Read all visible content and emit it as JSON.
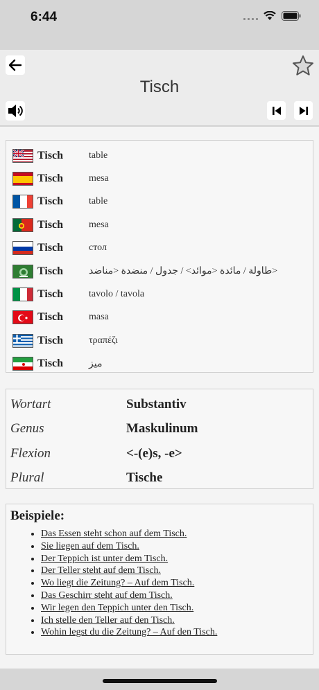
{
  "status": {
    "time": "6:44"
  },
  "header": {
    "title": "Tisch"
  },
  "translations": [
    {
      "flag": "us-uk",
      "word": "Tisch",
      "translation": "table"
    },
    {
      "flag": "spain",
      "word": "Tisch",
      "translation": "mesa"
    },
    {
      "flag": "france",
      "word": "Tisch",
      "translation": "table"
    },
    {
      "flag": "portugal",
      "word": "Tisch",
      "translation": "mesa"
    },
    {
      "flag": "russia",
      "word": "Tisch",
      "translation": "стол"
    },
    {
      "flag": "arabic",
      "word": "Tisch",
      "translation": "طاولة / مائدة <موائد> / جدول / منضدة <مناضد>"
    },
    {
      "flag": "italy",
      "word": "Tisch",
      "translation": "tavolo / tavola"
    },
    {
      "flag": "turkey",
      "word": "Tisch",
      "translation": "masa"
    },
    {
      "flag": "greece",
      "word": "Tisch",
      "translation": "τραπέζι"
    },
    {
      "flag": "iran",
      "word": "Tisch",
      "translation": "میز"
    }
  ],
  "grammar": [
    {
      "label": "Wortart",
      "value": "Substantiv"
    },
    {
      "label": "Genus",
      "value": "Maskulinum"
    },
    {
      "label": "Flexion",
      "value": "<-(e)s, -e>"
    },
    {
      "label": "Plural",
      "value": "Tische"
    }
  ],
  "examples": {
    "title": "Beispiele:",
    "items": [
      "Das Essen steht schon auf dem Tisch.",
      "Sie liegen auf dem Tisch.",
      "Der Teppich ist unter dem Tisch.",
      "Der Teller steht auf dem Tisch.",
      "Wo liegt die Zeitung? – Auf dem Tisch.",
      "Das Geschirr steht auf dem Tisch.",
      "Wir legen den Teppich unter den Tisch.",
      "Ich stelle den Teller auf den Tisch.",
      "Wohin legst du die Zeitung? – Auf den Tisch."
    ]
  }
}
